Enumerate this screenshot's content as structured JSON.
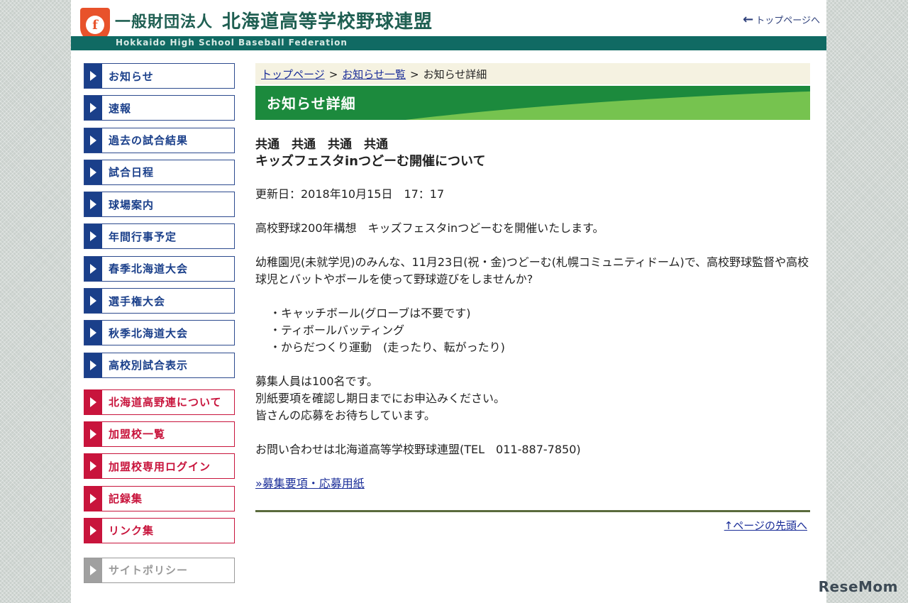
{
  "header": {
    "org_type": "一般財団法人",
    "org_name": "北海道高等学校野球連盟",
    "org_name_en": "Hokkaido High School Baseball Federation",
    "top_link": "トップページへ",
    "logo_letter": "f"
  },
  "sidebar": {
    "primary": [
      {
        "label": "お知らせ"
      },
      {
        "label": "速報"
      },
      {
        "label": "過去の試合結果"
      },
      {
        "label": "試合日程"
      },
      {
        "label": "球場案内"
      },
      {
        "label": "年間行事予定"
      },
      {
        "label": "春季北海道大会"
      },
      {
        "label": "選手権大会"
      },
      {
        "label": "秋季北海道大会"
      },
      {
        "label": "高校別試合表示"
      }
    ],
    "secondary": [
      {
        "label": "北海道高野連について"
      },
      {
        "label": "加盟校一覧"
      },
      {
        "label": "加盟校専用ログイン"
      },
      {
        "label": "記録集"
      },
      {
        "label": "リンク集"
      }
    ],
    "tertiary": [
      {
        "label": "サイトポリシー"
      }
    ]
  },
  "breadcrumb": {
    "home": "トップページ",
    "list": "お知らせ一覧",
    "current": "お知らせ詳細",
    "separator": ">"
  },
  "page_title": "お知らせ詳細",
  "article": {
    "categories": "共通　共通　共通　共通",
    "headline": "キッズフェスタinつどーむ開催について",
    "updated": "更新日：2018年10月15日　17：17",
    "intro": "高校野球200年構想　キッズフェスタinつどーむを開催いたします。",
    "body": "幼稚園児(未就学児)のみんな、11月23日(祝・金)つどーむ(札幌コミュニティドーム)で、高校野球監督や高校球児とバットやボールを使って野球遊びをしませんか?",
    "list": [
      "・キャッチボール(グローブは不要です)",
      "・ティボールバッティング",
      "・からだつくり運動　(走ったり、転がったり)"
    ],
    "recruit_1": "募集人員は100名です。",
    "recruit_2": "別紙要項を確認し期日までにお申込みください。",
    "recruit_3": "皆さんの応募をお待ちしています。",
    "contact": "お問い合わせは北海道高等学校野球連盟(TEL　011-887-7850)",
    "doc_link": "»募集要項・応募用紙"
  },
  "page_top": "↑ページの先頭へ",
  "watermark": "ReseMom",
  "colors": {
    "nav_blue": "#1a3f8a",
    "nav_red": "#c8143c",
    "header_green": "#106a63",
    "title_green": "#1c8a3d",
    "link": "#1a2d98"
  }
}
